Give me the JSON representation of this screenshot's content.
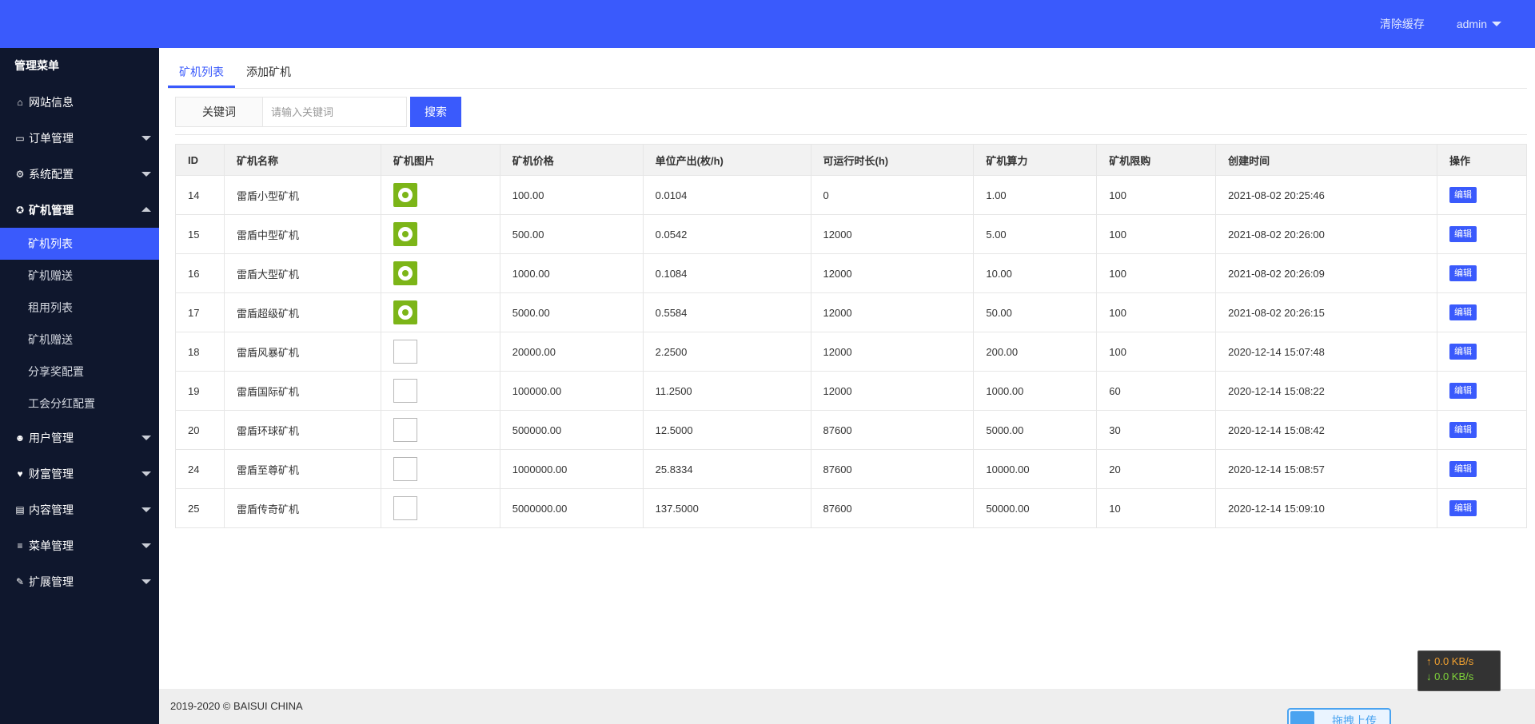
{
  "header": {
    "clear_cache": "清除缓存",
    "user": "admin"
  },
  "sidebar": {
    "title": "管理菜单",
    "items": [
      {
        "label": "网站信息",
        "icon": "home-icon"
      },
      {
        "label": "订单管理",
        "icon": "card-icon"
      },
      {
        "label": "系统配置",
        "icon": "gears-icon"
      },
      {
        "label": "矿机管理",
        "icon": "rebel-icon"
      },
      {
        "label": "用户管理",
        "icon": "users-icon"
      },
      {
        "label": "财富管理",
        "icon": "heartbeat-icon"
      },
      {
        "label": "内容管理",
        "icon": "document-icon"
      },
      {
        "label": "菜单管理",
        "icon": "bars-icon"
      },
      {
        "label": "扩展管理",
        "icon": "wrench-icon"
      }
    ],
    "sub_items": [
      "矿机列表",
      "矿机赠送",
      "租用列表",
      "矿机赠送",
      "分享奖配置",
      "工会分红配置"
    ]
  },
  "tabs": [
    "矿机列表",
    "添加矿机"
  ],
  "search": {
    "label": "关键词",
    "placeholder": "请输入关键词",
    "button": "搜索"
  },
  "table": {
    "headers": [
      "ID",
      "矿机名称",
      "矿机图片",
      "矿机价格",
      "单位产出(枚/h)",
      "可运行时长(h)",
      "矿机算力",
      "矿机限购",
      "创建时间",
      "操作"
    ],
    "edit_label": "编辑",
    "rows": [
      {
        "id": "14",
        "name": "雷盾小型矿机",
        "img": "logo",
        "price": "100.00",
        "output": "0.0104",
        "runtime": "0",
        "power": "1.00",
        "limit": "100",
        "created": "2021-08-02 20:25:46"
      },
      {
        "id": "15",
        "name": "雷盾中型矿机",
        "img": "logo",
        "price": "500.00",
        "output": "0.0542",
        "runtime": "12000",
        "power": "5.00",
        "limit": "100",
        "created": "2021-08-02 20:26:00"
      },
      {
        "id": "16",
        "name": "雷盾大型矿机",
        "img": "logo",
        "price": "1000.00",
        "output": "0.1084",
        "runtime": "12000",
        "power": "10.00",
        "limit": "100",
        "created": "2021-08-02 20:26:09"
      },
      {
        "id": "17",
        "name": "雷盾超级矿机",
        "img": "logo",
        "price": "5000.00",
        "output": "0.5584",
        "runtime": "12000",
        "power": "50.00",
        "limit": "100",
        "created": "2021-08-02 20:26:15"
      },
      {
        "id": "18",
        "name": "雷盾风暴矿机",
        "img": "broken",
        "price": "20000.00",
        "output": "2.2500",
        "runtime": "12000",
        "power": "200.00",
        "limit": "100",
        "created": "2020-12-14 15:07:48"
      },
      {
        "id": "19",
        "name": "雷盾国际矿机",
        "img": "broken",
        "price": "100000.00",
        "output": "11.2500",
        "runtime": "12000",
        "power": "1000.00",
        "limit": "60",
        "created": "2020-12-14 15:08:22"
      },
      {
        "id": "20",
        "name": "雷盾环球矿机",
        "img": "broken",
        "price": "500000.00",
        "output": "12.5000",
        "runtime": "87600",
        "power": "5000.00",
        "limit": "30",
        "created": "2020-12-14 15:08:42"
      },
      {
        "id": "24",
        "name": "雷盾至尊矿机",
        "img": "broken",
        "price": "1000000.00",
        "output": "25.8334",
        "runtime": "87600",
        "power": "10000.00",
        "limit": "20",
        "created": "2020-12-14 15:08:57"
      },
      {
        "id": "25",
        "name": "雷盾传奇矿机",
        "img": "broken",
        "price": "5000000.00",
        "output": "137.5000",
        "runtime": "87600",
        "power": "50000.00",
        "limit": "10",
        "created": "2020-12-14 15:09:10"
      }
    ]
  },
  "footer": {
    "copyright": "2019-2020 © BAISUI CHINA"
  },
  "speed_widget": {
    "up": "↑ 0.0 KB/s",
    "down": "↓ 0.0 KB/s"
  },
  "upload_widget": {
    "label": "拖拽上传"
  },
  "colors": {
    "primary": "#3a5afc",
    "sidebar_bg": "#0f172d",
    "image_green": "#7cb518"
  }
}
